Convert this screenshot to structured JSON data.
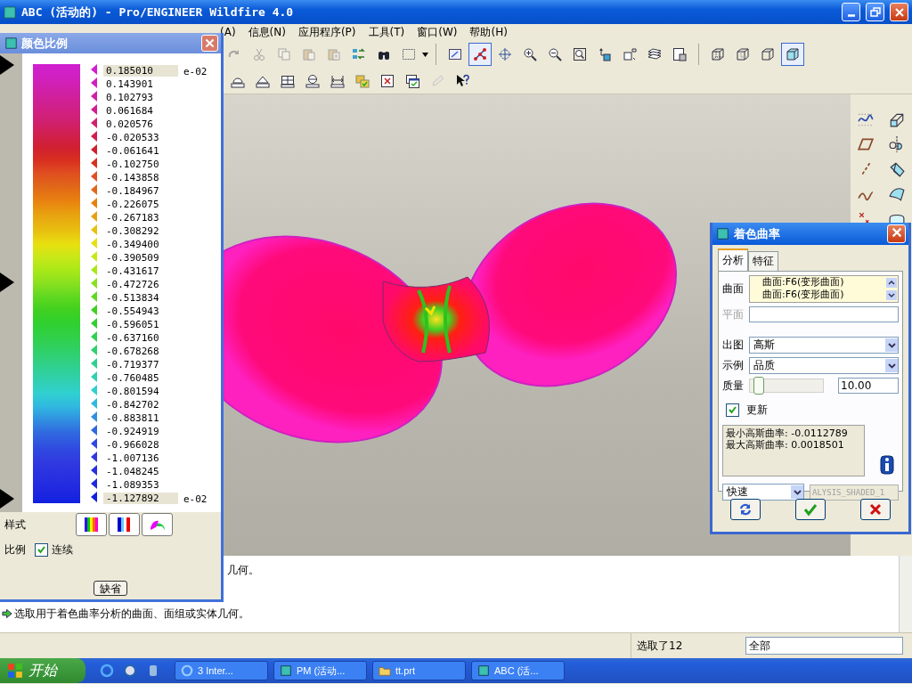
{
  "window": {
    "title": "ABC (活动的) - Pro/ENGINEER Wildfire 4.0"
  },
  "menu": [
    "(A)",
    "信息(N)",
    "应用程序(P)",
    "工具(T)",
    "窗口(W)",
    "帮助(H)"
  ],
  "toolbar_top": [
    {
      "disabled": true,
      "selected": false
    },
    {
      "disabled": true,
      "selected": false
    },
    {
      "disabled": true,
      "selected": false
    },
    {
      "disabled": true,
      "selected": false
    },
    {
      "disabled": true,
      "selected": false
    },
    {
      "disabled": false,
      "selected": false
    },
    {
      "disabled": false,
      "selected": false
    },
    {
      "disabled": false,
      "selected": false
    },
    {
      "disabled": false,
      "selected": false
    },
    {
      "disabled": false,
      "selected": true
    },
    {
      "disabled": false,
      "selected": false
    },
    {
      "disabled": false,
      "selected": false
    },
    {
      "disabled": false,
      "selected": false
    },
    {
      "disabled": false,
      "selected": false
    },
    {
      "disabled": false,
      "selected": false
    },
    {
      "disabled": false,
      "selected": false
    },
    {
      "disabled": false,
      "selected": false
    },
    {
      "disabled": false,
      "selected": false
    },
    {
      "disabled": false,
      "selected": false
    },
    {
      "disabled": false,
      "selected": false
    },
    {
      "disabled": false,
      "selected": false
    },
    {
      "disabled": false,
      "selected": true
    }
  ],
  "toolbar_bottom": [
    {
      "disabled": false
    },
    {
      "disabled": false
    },
    {
      "disabled": false
    },
    {
      "disabled": false
    },
    {
      "disabled": false
    },
    {
      "disabled": false
    },
    {
      "disabled": false
    },
    {
      "disabled": false
    },
    {
      "disabled": true
    },
    {
      "disabled": false
    }
  ],
  "messages": [
    {
      "kind": "cut",
      "text": "几何。"
    },
    {
      "kind": "full",
      "text": "选取用于着色曲率分析的曲面、面组或实体几何。"
    }
  ],
  "status_bar": {
    "selection": "选取了12",
    "filter": "全部"
  },
  "taskbar": {
    "start": "开始",
    "items": [
      "3 Inter...",
      "PM (活动...",
      "tt.prt",
      "ABC (活..."
    ]
  },
  "color_scale": {
    "title": "颜色比例",
    "unit_top": "e-02",
    "unit_bottom": "e-02",
    "ticks": [
      {
        "value": "0.185010",
        "color": "#d020d0",
        "kind": "field"
      },
      {
        "value": "0.143901",
        "color": "#d020c0",
        "kind": "label"
      },
      {
        "value": "0.102793",
        "color": "#d020a8",
        "kind": "label"
      },
      {
        "value": "0.061684",
        "color": "#d02090",
        "kind": "label"
      },
      {
        "value": "0.020576",
        "color": "#d02070",
        "kind": "label"
      },
      {
        "value": "-0.020533",
        "color": "#d02050",
        "kind": "label"
      },
      {
        "value": "-0.061641",
        "color": "#d02030",
        "kind": "label"
      },
      {
        "value": "-0.102750",
        "color": "#d83020",
        "kind": "label"
      },
      {
        "value": "-0.143858",
        "color": "#e05020",
        "kind": "label"
      },
      {
        "value": "-0.184967",
        "color": "#e06818",
        "kind": "label"
      },
      {
        "value": "-0.226075",
        "color": "#e88010",
        "kind": "label"
      },
      {
        "value": "-0.267183",
        "color": "#e8a010",
        "kind": "label"
      },
      {
        "value": "-0.308292",
        "color": "#e8c010",
        "kind": "label"
      },
      {
        "value": "-0.349400",
        "color": "#e8e010",
        "kind": "label"
      },
      {
        "value": "-0.390509",
        "color": "#c8e818",
        "kind": "label"
      },
      {
        "value": "-0.431617",
        "color": "#a8e818",
        "kind": "label"
      },
      {
        "value": "-0.472726",
        "color": "#88e020",
        "kind": "label"
      },
      {
        "value": "-0.513834",
        "color": "#60d820",
        "kind": "label"
      },
      {
        "value": "-0.554943",
        "color": "#40d020",
        "kind": "label"
      },
      {
        "value": "-0.596051",
        "color": "#30d030",
        "kind": "label"
      },
      {
        "value": "-0.637160",
        "color": "#30d050",
        "kind": "label"
      },
      {
        "value": "-0.678268",
        "color": "#30d070",
        "kind": "label"
      },
      {
        "value": "-0.719377",
        "color": "#30d090",
        "kind": "label"
      },
      {
        "value": "-0.760485",
        "color": "#30d0b0",
        "kind": "label"
      },
      {
        "value": "-0.801594",
        "color": "#30d0d0",
        "kind": "label"
      },
      {
        "value": "-0.842702",
        "color": "#30b8e0",
        "kind": "label"
      },
      {
        "value": "-0.883811",
        "color": "#3090e0",
        "kind": "label"
      },
      {
        "value": "-0.924919",
        "color": "#3068e0",
        "kind": "label"
      },
      {
        "value": "-0.966028",
        "color": "#3048e0",
        "kind": "label"
      },
      {
        "value": "-1.007136",
        "color": "#3038e0",
        "kind": "label"
      },
      {
        "value": "-1.048245",
        "color": "#2830e0",
        "kind": "label"
      },
      {
        "value": "-1.089353",
        "color": "#2028e0",
        "kind": "label"
      },
      {
        "value": "-1.127892",
        "color": "#1020e0",
        "kind": "field"
      }
    ],
    "style_label": "样式",
    "scale_label": "比例",
    "continuous": {
      "label": "连续",
      "checked": true
    },
    "default_button": "缺省"
  },
  "dialog": {
    "title": "着色曲率",
    "tabs": [
      {
        "label": "分析",
        "selected": true
      },
      {
        "label": "特征",
        "selected": false
      }
    ],
    "surface": {
      "label": "曲面",
      "items": [
        "曲面:F6(变形曲面)",
        "曲面:F6(变形曲面)"
      ]
    },
    "plane": {
      "label": "平面",
      "disabled": true
    },
    "output": {
      "label": "出图",
      "value": "高斯"
    },
    "display": {
      "label": "示例",
      "value": "品质"
    },
    "quality": {
      "label": "质量",
      "level": 0.05,
      "value": "10.00"
    },
    "update": {
      "label": "更新",
      "checked": true
    },
    "results": [
      "最小高斯曲率: -0.0112789",
      "最大高斯曲率: 0.0018501"
    ],
    "mode": "快速",
    "feature_name": "ALYSIS_SHADED_1"
  }
}
